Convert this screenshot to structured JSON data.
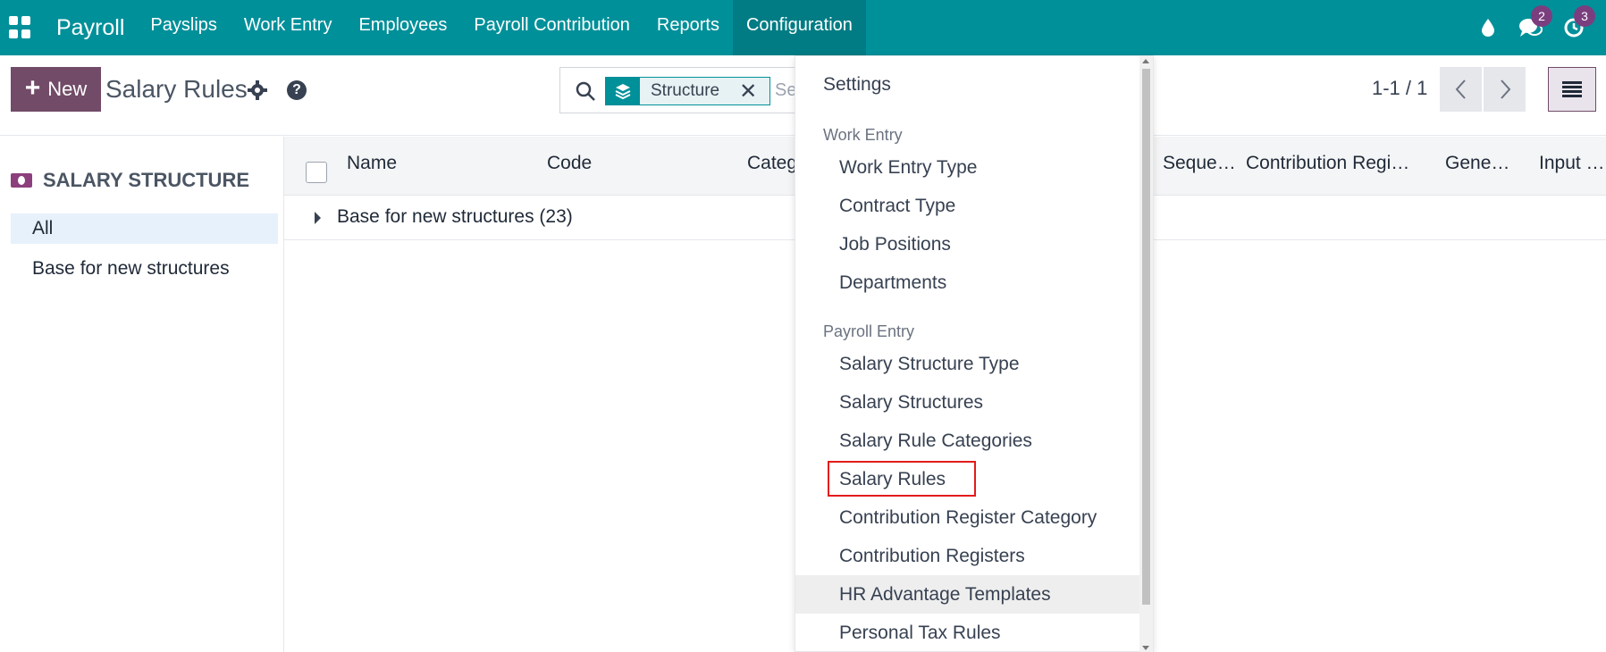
{
  "navbar": {
    "brand": "Payroll",
    "menu": [
      "Payslips",
      "Work Entry",
      "Employees",
      "Payroll Contribution",
      "Reports",
      "Configuration"
    ],
    "active_menu": "Configuration",
    "messages_badge": "2",
    "activities_badge": "3"
  },
  "control": {
    "new_label": "New",
    "title": "Salary Rules",
    "help_glyph": "?",
    "facet_label": "Structure",
    "facet_remove": "✕",
    "search_placeholder": "Se",
    "pager": "1-1 / 1"
  },
  "sidebar": {
    "header": "SALARY STRUCTURE",
    "items": [
      "All",
      "Base for new structures"
    ],
    "active": "All"
  },
  "list": {
    "columns": [
      "Name",
      "Code",
      "Categ",
      "Seque…",
      "Contribution Regi…",
      "Gene…",
      "Input …"
    ],
    "group": "Base for new structures (23)"
  },
  "dropdown": {
    "top_item": "Settings",
    "sections": [
      {
        "title": "Work Entry",
        "items": [
          "Work Entry Type",
          "Contract Type",
          "Job Positions",
          "Departments"
        ]
      },
      {
        "title": "Payroll Entry",
        "items": [
          "Salary Structure Type",
          "Salary Structures",
          "Salary Rule Categories",
          "Salary Rules",
          "Contribution Register Category",
          "Contribution Registers",
          "HR Advantage Templates",
          "Personal Tax Rules"
        ]
      }
    ],
    "highlighted_item": "Salary Rules",
    "hovered_item": "HR Advantage Templates"
  },
  "colors": {
    "navbar": "#00909a",
    "primary": "#714b67",
    "highlight_border": "#e31b1b"
  }
}
